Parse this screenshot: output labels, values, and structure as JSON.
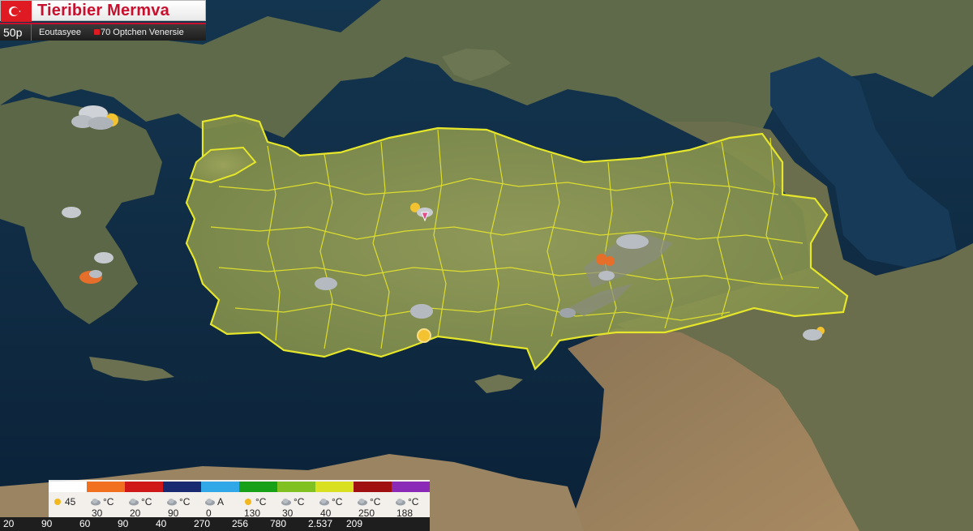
{
  "header": {
    "title": "Tieribier Mermva",
    "time": "50p",
    "region": "Eoutasyee",
    "info": "70 Optchen Venersie"
  },
  "legend": {
    "colors": [
      "#ffffff",
      "#f07020",
      "#d01818",
      "#1a2a70",
      "#30a8e8",
      "#18a018",
      "#80c020",
      "#d8e020",
      "#a01010",
      "#8c2ab8"
    ],
    "labels": [
      {
        "icon": "sun-icon",
        "text": "45"
      },
      {
        "icon": "cloud-icon",
        "text": "°C"
      },
      {
        "icon": "cloud-icon",
        "text": "°C"
      },
      {
        "icon": "cloud-icon",
        "text": "°C"
      },
      {
        "icon": "cloud-icon",
        "text": "A"
      },
      {
        "icon": "sun-icon",
        "text": "°C"
      },
      {
        "icon": "cloud-icon",
        "text": "°C"
      },
      {
        "icon": "cloud-icon",
        "text": "°C"
      },
      {
        "icon": "cloud-icon",
        "text": "°C"
      },
      {
        "icon": "cloud-icon",
        "text": "°C"
      }
    ],
    "row2": [
      "",
      "30",
      "20",
      "90",
      "0",
      "130",
      "30",
      "40",
      "250",
      "188"
    ],
    "footer": [
      "20",
      "90",
      "60",
      "90",
      "40",
      "270",
      "256",
      "780",
      "2.537",
      "209"
    ]
  }
}
